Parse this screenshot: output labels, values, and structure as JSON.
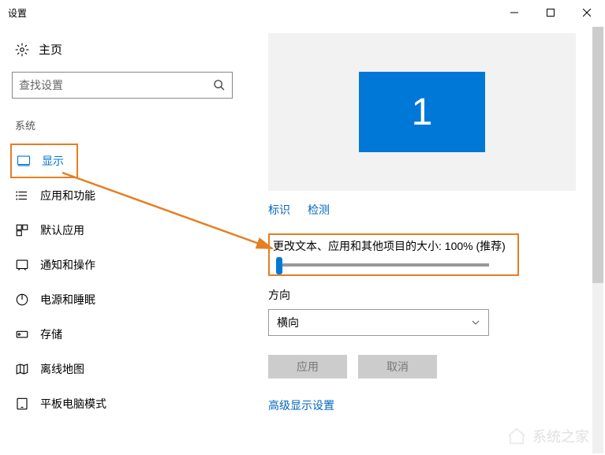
{
  "titlebar": {
    "title": "设置"
  },
  "home": {
    "label": "主页"
  },
  "search": {
    "placeholder": "查找设置"
  },
  "category": "系统",
  "nav": {
    "display": "显示",
    "apps": "应用和功能",
    "default_apps": "默认应用",
    "notifications": "通知和操作",
    "power": "电源和睡眠",
    "storage": "存储",
    "offline_maps": "离线地图",
    "tablet": "平板电脑模式"
  },
  "monitor": {
    "number": "1"
  },
  "links": {
    "identify": "标识",
    "detect": "检测"
  },
  "scale": {
    "label": "更改文本、应用和其他项目的大小: 100% (推荐)"
  },
  "orientation": {
    "label": "方向",
    "value": "横向"
  },
  "buttons": {
    "apply": "应用",
    "cancel": "取消"
  },
  "advanced": "高级显示设置",
  "watermark": "系统之家"
}
